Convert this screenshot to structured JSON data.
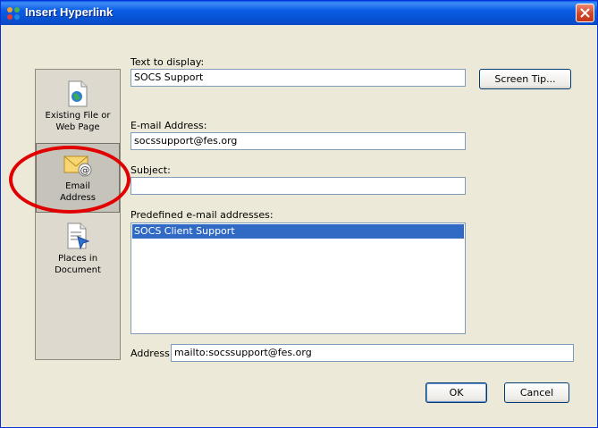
{
  "window": {
    "title": "Insert Hyperlink",
    "close_icon": "close-icon",
    "colors": {
      "titlebar": "#0a58e8",
      "dialog_bg": "#ece9d8",
      "selection": "#316ac5",
      "annotation": "#e00000"
    }
  },
  "sidebar": {
    "items": [
      {
        "label_line1": "Existing File or",
        "label_line2": "Web Page",
        "icon": "globe-document-icon"
      },
      {
        "label_line1": "Email",
        "label_line2": "Address",
        "icon": "email-envelope-icon",
        "selected": true
      },
      {
        "label_line1": "Places in",
        "label_line2": "Document",
        "icon": "document-bookmark-icon"
      }
    ]
  },
  "form": {
    "text_to_display_label": "Text to display:",
    "text_to_display_value": "SOCS Support",
    "screen_tip_button": "Screen Tip...",
    "email_label": "E-mail Address:",
    "email_value": "socssupport@fes.org",
    "subject_label": "Subject:",
    "subject_value": "",
    "predefined_label": "Predefined e-mail addresses:",
    "predefined_items": [
      "SOCS Client Support"
    ],
    "address_label": "Address:",
    "address_value": "mailto:socssupport@fes.org"
  },
  "buttons": {
    "ok": "OK",
    "cancel": "Cancel"
  }
}
